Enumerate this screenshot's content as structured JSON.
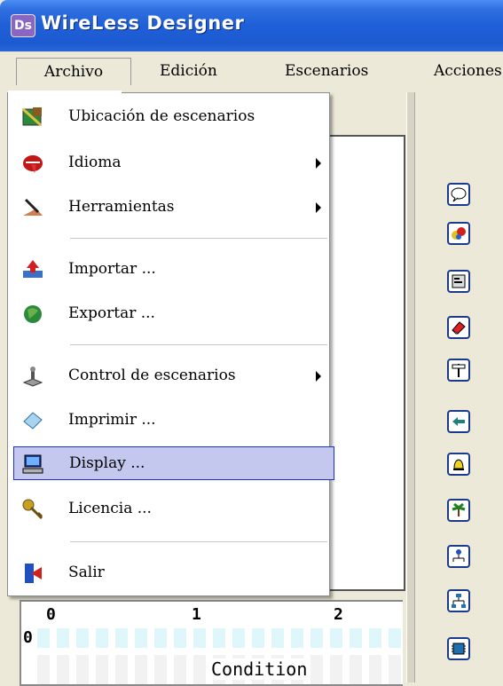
{
  "window": {
    "title": "WireLess Designer",
    "icon_text": "Ds"
  },
  "menubar": {
    "archivo": "Archivo",
    "edicion": "Edición",
    "escenarios": "Escenarios",
    "acciones": "Acciones"
  },
  "dropdown": {
    "items": [
      {
        "label": "Ubicación de escenarios",
        "icon": "folder-map-icon",
        "submenu": false
      },
      {
        "label": "Idioma",
        "icon": "language-lips-icon",
        "submenu": true
      },
      {
        "label": "Herramientas",
        "icon": "tools-icon",
        "submenu": true
      },
      {
        "label": "Importar ...",
        "icon": "import-icon",
        "submenu": false
      },
      {
        "label": "Exportar ...",
        "icon": "export-globe-icon",
        "submenu": false
      },
      {
        "label": "Control de escenarios",
        "icon": "joystick-icon",
        "submenu": true
      },
      {
        "label": "Imprimir ...",
        "icon": "print-icon",
        "submenu": false
      },
      {
        "label": "Display ...",
        "icon": "monitor-icon",
        "submenu": false,
        "highlighted": true
      },
      {
        "label": "Licencia ...",
        "icon": "key-icon",
        "submenu": false
      },
      {
        "label": "Salir",
        "icon": "exit-door-icon",
        "submenu": false
      }
    ]
  },
  "grid": {
    "col_labels": [
      "0",
      "1",
      "2"
    ],
    "row_labels": [
      "0"
    ],
    "condition_label": "Condition"
  },
  "toolbar": {
    "buttons": [
      "speech-bubble-icon",
      "abc-icon",
      "form-icon",
      "eraser-icon",
      "signpost-icon",
      "arrow-left-icon",
      "bell-icon",
      "palm-tree-icon",
      "network-node-icon",
      "hierarchy-icon",
      "chip-icon"
    ]
  },
  "colors": {
    "titlebar": "#2f6fe0",
    "highlight_fill": "#c4c8ee",
    "highlight_border": "#1d2fd6",
    "toolbar_border": "#1b3a8c"
  }
}
